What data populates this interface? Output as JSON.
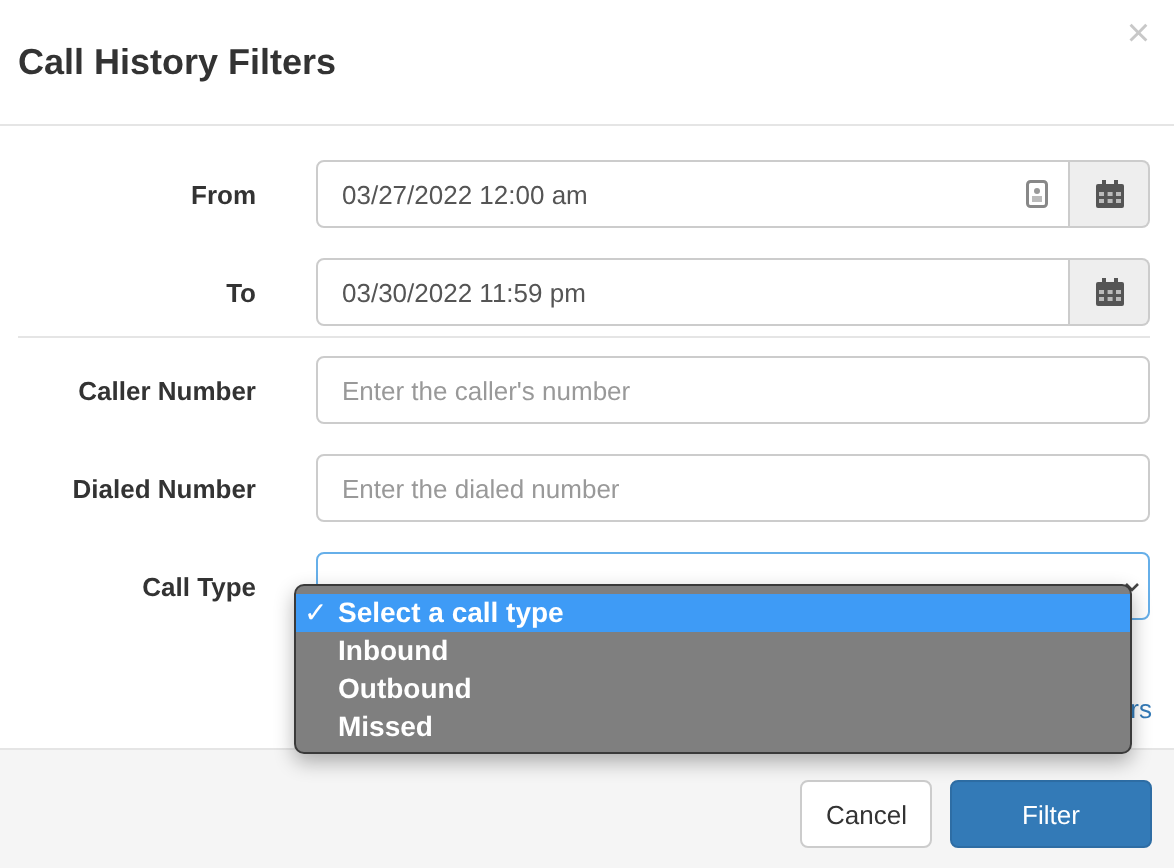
{
  "dialog": {
    "title": "Call History Filters",
    "close": "×"
  },
  "fields": [
    {
      "label": "From",
      "kind": "date",
      "value": "03/27/2022 12:00 am",
      "contact_icon": true
    },
    {
      "label": "To",
      "kind": "date",
      "value": "03/30/2022 11:59 pm",
      "contact_icon": false
    },
    {
      "label": "Caller Number",
      "kind": "text",
      "placeholder": "Enter the caller's number"
    },
    {
      "label": "Dialed Number",
      "kind": "text",
      "placeholder": "Enter the dialed number"
    },
    {
      "label": "Call Type",
      "kind": "select"
    }
  ],
  "dropdown": {
    "options": [
      {
        "label": "Select a call type",
        "selected": true
      },
      {
        "label": "Inbound",
        "selected": false
      },
      {
        "label": "Outbound",
        "selected": false
      },
      {
        "label": "Missed",
        "selected": false
      }
    ],
    "check": "✓"
  },
  "link_fragment": "rs",
  "buttons": [
    {
      "label": "Cancel",
      "kind": "default"
    },
    {
      "label": "Filter",
      "kind": "primary"
    }
  ]
}
